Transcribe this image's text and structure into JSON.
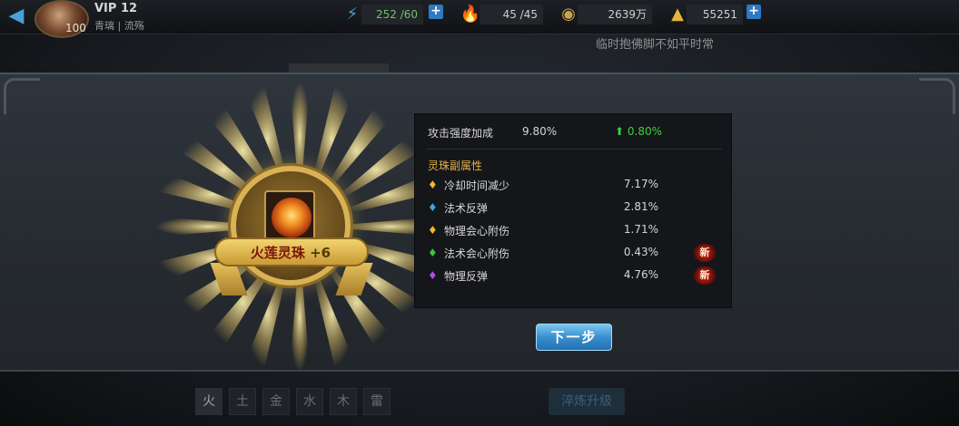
{
  "topbar": {
    "back_icon": "back-arrow-icon",
    "level": "100",
    "vip": "VIP 12",
    "player_sub": "青璃 | 流殇",
    "stamina": {
      "icon": "stamina-icon",
      "value": "252 /60"
    },
    "energy": {
      "icon": "energy-icon",
      "value": "45 /45"
    },
    "coins": {
      "icon": "coin-icon",
      "value": "2639万"
    },
    "ingots": {
      "icon": "ingot-icon",
      "value": "55251"
    },
    "plus_label": "+"
  },
  "notice": "临时抱佛脚不如平时常",
  "reward": {
    "name": "火莲灵珠",
    "plus": "+6"
  },
  "stats": {
    "main_label": "攻击强度加成",
    "main_value": "9.80%",
    "main_increase": "0.80%",
    "sub_title": "灵珠副属性",
    "rows": [
      {
        "label": "冷却时间减少",
        "value": "7.17%",
        "color": "#f2b630",
        "is_new": false
      },
      {
        "label": "法术反弹",
        "value": "2.81%",
        "color": "#3aa6e8",
        "is_new": false
      },
      {
        "label": "物理会心附伤",
        "value": "1.71%",
        "color": "#f2b630",
        "is_new": false
      },
      {
        "label": "法术会心附伤",
        "value": "0.43%",
        "color": "#3ec23e",
        "is_new": true
      },
      {
        "label": "物理反弹",
        "value": "4.76%",
        "color": "#b44ce0",
        "is_new": true
      }
    ],
    "new_label": "新"
  },
  "next_button": "下一步",
  "elements": [
    "火",
    "土",
    "金",
    "水",
    "木",
    "雷"
  ],
  "upgrade_button": "淬炼升级"
}
